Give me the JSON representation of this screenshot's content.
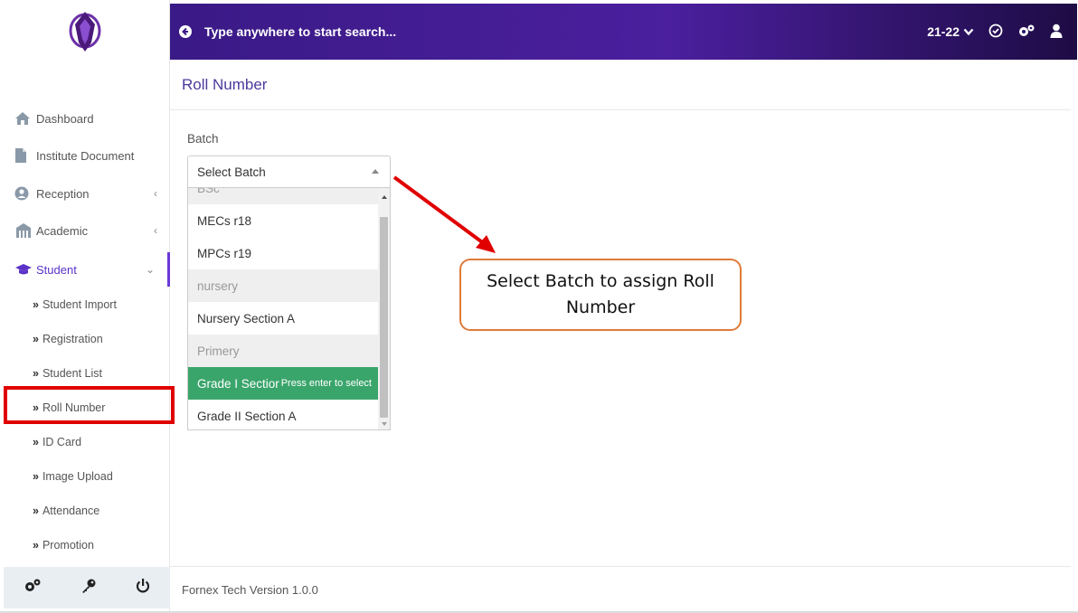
{
  "topbar": {
    "search_placeholder": "Type anywhere to start search...",
    "academic_year": "21-22"
  },
  "sidebar": {
    "items": [
      {
        "label": "Dashboard",
        "icon": "home-icon"
      },
      {
        "label": "Institute Document",
        "icon": "file-icon"
      },
      {
        "label": "Reception",
        "icon": "user-circle-icon"
      },
      {
        "label": "Academic",
        "icon": "building-icon"
      },
      {
        "label": "Student",
        "icon": "graduation-cap-icon"
      }
    ],
    "student_sub": [
      "Student Import",
      "Registration",
      "Student List",
      "Roll Number",
      "ID Card",
      "Image Upload",
      "Attendance",
      "Promotion"
    ]
  },
  "page": {
    "title": "Roll Number",
    "batch_label": "Batch",
    "select_value": "Select Batch"
  },
  "dropdown": {
    "options": [
      {
        "text": "BSc",
        "type": "group"
      },
      {
        "text": "MECs r18",
        "type": "option"
      },
      {
        "text": "MPCs r19",
        "type": "option"
      },
      {
        "text": "nursery",
        "type": "group"
      },
      {
        "text": "Nursery Section A",
        "type": "option"
      },
      {
        "text": "Primery",
        "type": "group"
      },
      {
        "text": "Grade I Sectior",
        "type": "selected",
        "hint": "Press enter to select"
      },
      {
        "text": "Grade II Section A",
        "type": "option"
      }
    ]
  },
  "callout": {
    "text": "Select Batch to assign Roll Number"
  },
  "footer": {
    "version": "Fornex Tech Version 1.0.0"
  },
  "colors": {
    "accent": "#4b1f9e",
    "selected_option": "#3aa56b",
    "highlight_border": "#e00000",
    "callout_border": "#e07b39"
  }
}
